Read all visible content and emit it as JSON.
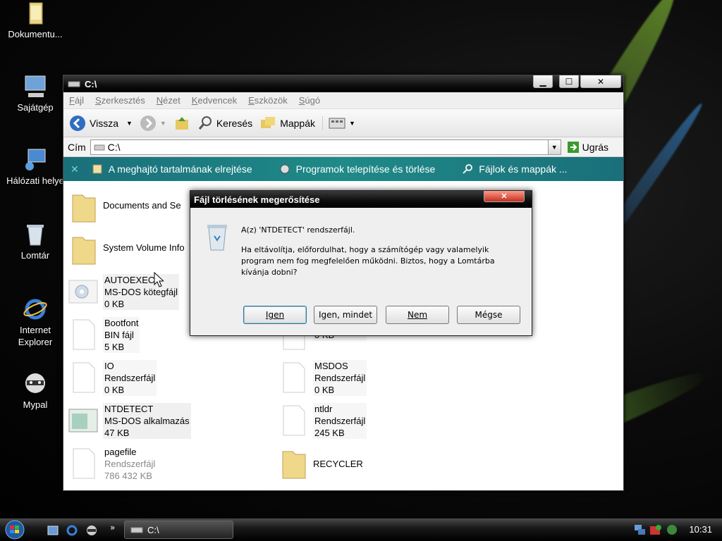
{
  "desktop": {
    "icons": [
      {
        "label": "Dokumentu..."
      },
      {
        "label": "Sajátgép"
      },
      {
        "label": "Hálózati helye"
      },
      {
        "label": "Lomtár"
      },
      {
        "label_line1": "Internet",
        "label_line2": "Explorer"
      },
      {
        "label": "Mypal"
      }
    ]
  },
  "window": {
    "title": "C:\\",
    "menu": [
      "Fájl",
      "Szerkesztés",
      "Nézet",
      "Kedvencek",
      "Eszközök",
      "Súgó"
    ],
    "toolbar": {
      "back": "Vissza",
      "search": "Keresés",
      "folders": "Mappák"
    },
    "address": {
      "label": "Cím",
      "value": "C:\\",
      "go": "Ugrás"
    },
    "tasks": [
      "A meghajtó tartalmának elrejtése",
      "Programok telepítése és törlése",
      "Fájlok és mappák ..."
    ],
    "items": [
      {
        "name": "Documents and Se",
        "type": "",
        "size": ""
      },
      {
        "name": "System Volume Info",
        "type": "",
        "size": ""
      },
      {
        "name": "AUTOEXEC",
        "type": "MS-DOS kötegfájl",
        "size": "0 KB"
      },
      {
        "name": "Bootfont",
        "type": "BIN fájl",
        "size": "5 KB"
      },
      {
        "name": "IO",
        "type": "Rendszerfájl",
        "size": "0 KB"
      },
      {
        "name": "NTDETECT",
        "type": "MS-DOS alkalmazás",
        "size": "47 KB"
      },
      {
        "name": "pagefile",
        "type": "Rendszerfájl",
        "size": "786 432 KB"
      },
      {
        "name": "",
        "type": "Rendszerfájl",
        "size": "0 KB"
      },
      {
        "name": "MSDOS",
        "type": "Rendszerfájl",
        "size": "0 KB"
      },
      {
        "name": "ntldr",
        "type": "Rendszerfájl",
        "size": "245 KB"
      },
      {
        "name": "RECYCLER",
        "type": "",
        "size": ""
      }
    ]
  },
  "dialog": {
    "title": "Fájl törlésének megerősítése",
    "line1": "A(z) 'NTDETECT' rendszerfájl.",
    "line2": "Ha eltávolítja,  előfordulhat, hogy a számítógép vagy valamelyik",
    "line3": "program nem fog megfelelően működni. Biztos, hogy a Lomtárba",
    "line4": "kívánja dobni?",
    "buttons": {
      "yes": "Igen",
      "yes_all": "Igen, mindet",
      "no": "Nem",
      "cancel": "Mégse"
    }
  },
  "taskbar": {
    "task": "C:\\",
    "clock": "10:31"
  }
}
